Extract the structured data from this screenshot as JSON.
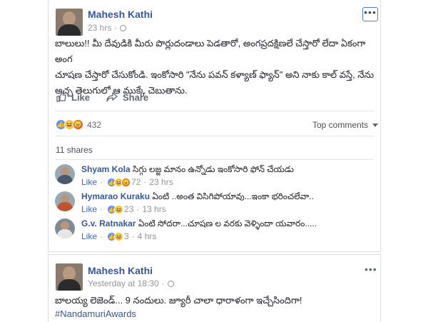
{
  "post1": {
    "author": "Mahesh Kathi",
    "time": "23 hrs",
    "text_line1": "బాలులు!! మీ దేవుడికి మీరు పొర్లుదండాలు పెడతారో, అంగప్రదక్షిణలే చేస్తారో లేదా ఏకంగా అంగ",
    "text_line2": "చూషణ చేస్తారో చేసుకోండి. ఇంకోసారి \"నేను పవన్ కళ్యాణ్ ఫ్యాన్\" అని నాకు కాల్ వస్తే, నేను",
    "text_line3": "అచ్చ తెలుగులో ఆ ముక్కే చెబుతాను.",
    "like_label": "Like",
    "share_label": "Share",
    "reaction_count": "432",
    "top_comments_label": "Top comments",
    "shares_label": "11 shares",
    "comments": [
      {
        "name": "Shyam Kola",
        "text": "సిగ్గు లజ్జ మానం ఉన్నోడు ఇంకోసారి ఫోన్ చేయడు",
        "like": "Like",
        "count": "72",
        "time": "23 hrs"
      },
      {
        "name": "Hymarao Kuraku",
        "text": "ఏంటి ..అంత విసిగిపోయావు...ఇంకా భరించలేవా..",
        "like": "Like",
        "count": "23",
        "time": "13 hrs"
      },
      {
        "name": "G.v. Ratnakar",
        "text": "ఏంటి సోదరా...చూషణ ల వరకు వెళ్ళిందా యవారం.....",
        "like": "Like",
        "count": "3",
        "time": "4 hrs"
      }
    ]
  },
  "post2": {
    "author": "Mahesh Kathi",
    "time": "Yesterday at 18:30",
    "text_line1": "బాలయ్య లెజెండ్... 9 నందులు. జ్యూరీ చాలా ధారాళంగా ఇచ్చేసిందిగా!",
    "hashtag": "#NandamuriAwards"
  },
  "colors": {
    "link": "#365899",
    "meta": "#90949c",
    "like_reaction": "#5890ff",
    "haha_reaction": "#f7c94a",
    "angry_reaction": "#e85a2a"
  },
  "icons": [
    "globe-icon",
    "more-options-icon",
    "like-icon",
    "share-icon",
    "like-reaction-icon",
    "haha-reaction-icon",
    "angry-reaction-icon",
    "caret-down-icon"
  ]
}
